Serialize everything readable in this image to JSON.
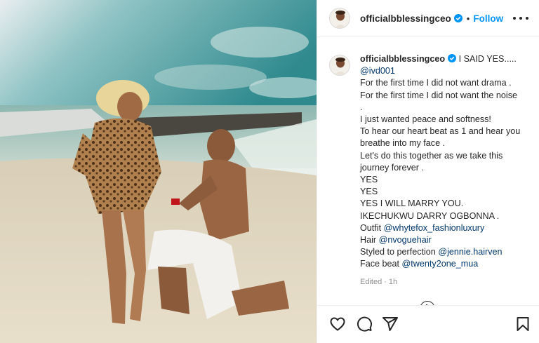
{
  "header": {
    "username": "officialbblessingceo",
    "separator": "•",
    "follow_label": "Follow"
  },
  "caption": {
    "username": "officialbblessingceo",
    "first_text": " I SAID YES.....",
    "mention_1": "@ivd001",
    "lines": [
      "For the first time I did not want drama .",
      "For the first time I did not want the noise",
      ".",
      "I just wanted peace and softness!",
      "To hear our heart beat as 1 and hear you breathe into my face .",
      "Let's do this together as we take this journey forever .",
      "YES",
      "YES",
      "YES I WILL MARRY YOU.",
      "IKECHUKWU DARRY OGBONNA ."
    ],
    "credits": [
      {
        "label": "Outfit ",
        "handle": "@whytefox_fashionluxury"
      },
      {
        "label": "Hair ",
        "handle": "@nvoguehair"
      },
      {
        "label": "Styled to perfection ",
        "handle": "@jennie.hairven"
      },
      {
        "label": "Face beat ",
        "handle": "@twenty2one_mua"
      }
    ],
    "edited": "Edited",
    "meta_sep": "·",
    "time": "1h"
  },
  "icons": {
    "verified": "verified-badge-icon",
    "more": "more-options-icon",
    "like": "heart-icon",
    "comment": "comment-icon",
    "share": "share-icon",
    "save": "bookmark-icon",
    "load_more": "plus-circle-icon"
  },
  "colors": {
    "link": "#0095f6",
    "mention": "#00376b",
    "text": "#262626",
    "muted": "#8e8e8e"
  }
}
